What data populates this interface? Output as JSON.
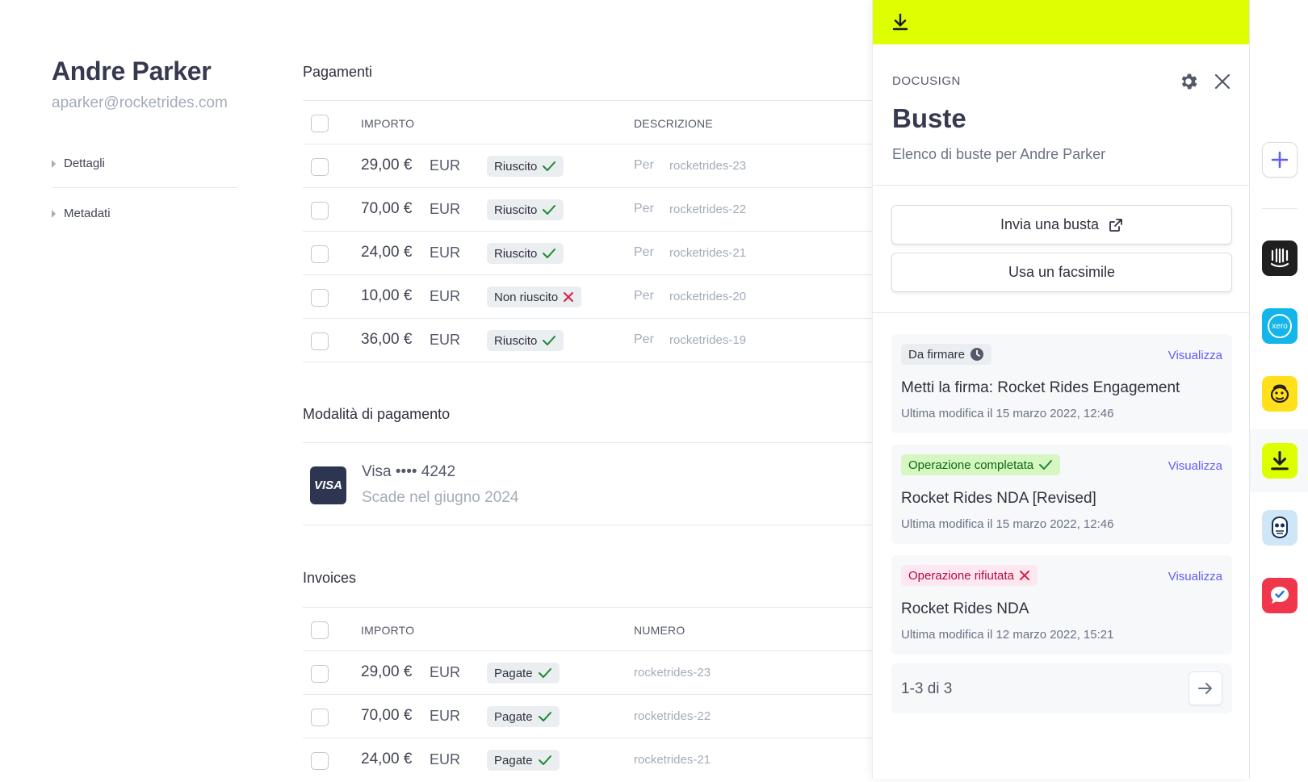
{
  "customer": {
    "name": "Andre Parker",
    "email": "aparker@rocketrides.com",
    "sections": [
      "Dettagli",
      "Metadati"
    ]
  },
  "payments": {
    "title": "Pagamenti",
    "headers": {
      "amount": "IMPORTO",
      "description": "DESCRIZIONE"
    },
    "rows": [
      {
        "amount": "29,00 €",
        "currency": "EUR",
        "status": "Riuscito",
        "ok": true,
        "per": "Per",
        "ref": "rocketrides-23"
      },
      {
        "amount": "70,00 €",
        "currency": "EUR",
        "status": "Riuscito",
        "ok": true,
        "per": "Per",
        "ref": "rocketrides-22"
      },
      {
        "amount": "24,00 €",
        "currency": "EUR",
        "status": "Riuscito",
        "ok": true,
        "per": "Per",
        "ref": "rocketrides-21"
      },
      {
        "amount": "10,00 €",
        "currency": "EUR",
        "status": "Non riuscito",
        "ok": false,
        "per": "Per",
        "ref": "rocketrides-20"
      },
      {
        "amount": "36,00 €",
        "currency": "EUR",
        "status": "Riuscito",
        "ok": true,
        "per": "Per",
        "ref": "rocketrides-19"
      }
    ]
  },
  "payment_methods": {
    "title": "Modalità di pagamento",
    "card_brand_logo": "VISA",
    "card_line": "Visa •••• 4242",
    "expiry": "Scade nel giugno 2024"
  },
  "invoices": {
    "title": "Invoices",
    "headers": {
      "amount": "IMPORTO",
      "number": "NUMERO"
    },
    "rows": [
      {
        "amount": "29,00 €",
        "currency": "EUR",
        "status": "Pagate",
        "ref": "rocketrides-23"
      },
      {
        "amount": "70,00 €",
        "currency": "EUR",
        "status": "Pagate",
        "ref": "rocketrides-22"
      },
      {
        "amount": "24,00 €",
        "currency": "EUR",
        "status": "Pagate",
        "ref": "rocketrides-21"
      }
    ]
  },
  "panel": {
    "accent_color": "#deff00",
    "eyebrow": "DOCUSIGN",
    "title": "Buste",
    "subtitle": "Elenco di buste per Andre Parker",
    "primary_button": "Invia una busta",
    "secondary_button": "Usa un facsimile",
    "envelopes": [
      {
        "status": "Da firmare",
        "status_icon": "clock-icon",
        "status_bg": "#ebeef1",
        "status_color": "#30313d",
        "view": "Visualizza",
        "title": "Metti la firma: Rocket Rides Engagement",
        "meta": "Ultima modifica il 15 marzo 2022, 12:46"
      },
      {
        "status": "Operazione completata",
        "status_icon": "check-icon",
        "status_bg": "#d7f7c2",
        "status_color": "#05690d",
        "view": "Visualizza",
        "title": "Rocket Rides NDA [Revised]",
        "meta": "Ultima modifica il 15 marzo 2022, 12:46"
      },
      {
        "status": "Operazione rifiutata",
        "status_icon": "x-icon",
        "status_bg": "#ffe7f2",
        "status_color": "#b3093c",
        "view": "Visualizza",
        "title": "Rocket Rides NDA",
        "meta": "Ultima modifica il 12 marzo 2022, 15:21"
      }
    ],
    "pagination": "1-3 di 3"
  },
  "app_rail": {
    "apps": [
      "plus-icon",
      "intercom-icon",
      "xero-icon",
      "mailchimp-icon",
      "docusign-download-icon",
      "hootsuite-owl-icon",
      "chat-check-icon"
    ],
    "xero_label": "xero"
  }
}
